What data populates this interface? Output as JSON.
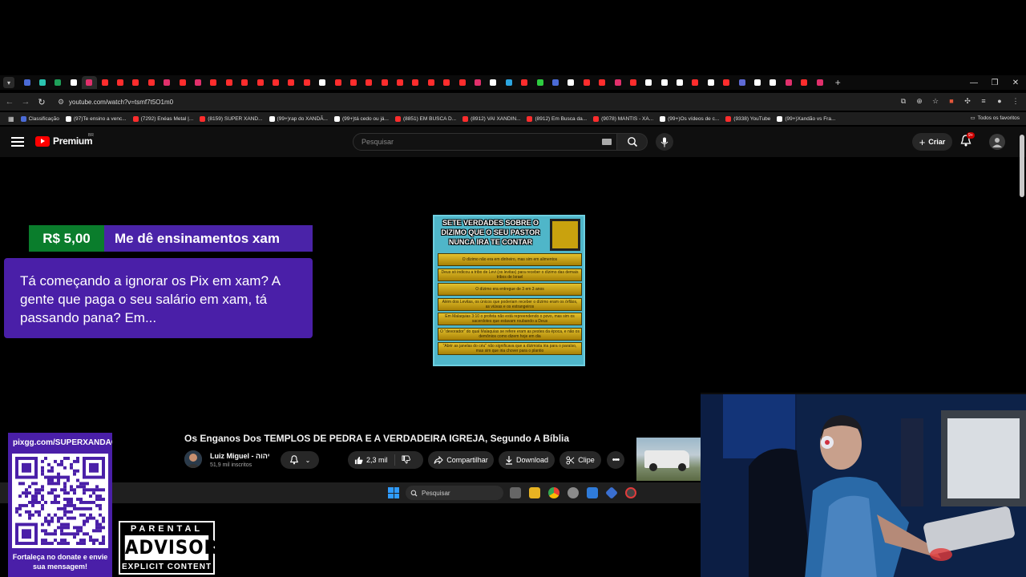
{
  "browser": {
    "url": "youtube.com/watch?v=tsmf7t5O1m0",
    "bookmarks": [
      {
        "label": "Classificação",
        "color": "#4b6bd6"
      },
      {
        "label": "(97)Te ensino a venc...",
        "color": "#ffffff"
      },
      {
        "label": "(7292) Enéas Metal |...",
        "color": "#ff2d2d"
      },
      {
        "label": "(8159) SUPER XAND...",
        "color": "#ff2d2d"
      },
      {
        "label": "(99+)rap do XANDÃ...",
        "color": "#ffffff"
      },
      {
        "label": "(99+)tá cedo ou já...",
        "color": "#ffffff"
      },
      {
        "label": "(8851) EM BUSCA D...",
        "color": "#ff2d2d"
      },
      {
        "label": "(8912) VAI XANDIN...",
        "color": "#ff2d2d"
      },
      {
        "label": "(8912) Em Busca da...",
        "color": "#ff2d2d"
      },
      {
        "label": "(9078) MANTIS - XA...",
        "color": "#ff2d2d"
      },
      {
        "label": "(99+)Os vídeos de c...",
        "color": "#ffffff"
      },
      {
        "label": "(9338) YouTube",
        "color": "#ff2d2d"
      },
      {
        "label": "(99+)Xandão vs Fra...",
        "color": "#ffffff"
      }
    ],
    "bookmarks_all": "Todos os favoritos"
  },
  "youtube": {
    "brand": "Premium",
    "region": "BR",
    "search_placeholder": "Pesquisar",
    "create_label": "Criar",
    "notif_badge": "9+",
    "video_title": "Os Enganos Dos TEMPLOS DE PEDRA E A VERDADEIRA IGREJA, Segundo A Bíblia",
    "channel_name": "Luiz Miguel - יהוה",
    "channel_subs": "51,9 mil inscritos",
    "likes": "2,3 mil",
    "share_label": "Compartilhar",
    "download_label": "Download",
    "clip_label": "Clipe"
  },
  "thumbnail": {
    "title": "SETE VERDADES SOBRE O DIZIMO QUE O SEU PASTOR NUNCA IRA TE CONTAR",
    "rows": [
      "O dízimo não era em dinheiro, mas sim em alimentos",
      "Deus só indicou a tribo de Levi (os levitas) para receber o dízimo das demais tribos de Israel",
      "O dízimo era entregue de 3 em 3 anos",
      "Além dos Levitas, os únicos que poderiam receber o dízimo eram os órfãos, as viúvas e os estrangeiros",
      "Em Malaquias 3:10 o profeta não está repreendendo o povo, mas sim os sacerdotes que estavam roubando a Deus",
      "O \"devorador\" do qual Malaquias se refere eram as pestes da época, e não os demônios como dizem hoje em dia",
      "\"Abrir as janelas do céu\" não significava que a dizimista iria para o paraíso, mas sim que iria chover para o plantio"
    ]
  },
  "donation": {
    "amount": "R$ 5,00",
    "name": "Me dê ensinamentos xam",
    "message": "Tá começando a ignorar os Pix em xam? A gente que paga o seu salário em xam, tá passando pana? Em..."
  },
  "taskbar": {
    "search_placeholder": "Pesquisar"
  },
  "qr": {
    "url": "pixgg.com/SUPERXANDAO",
    "caption": "Fortaleça no donate e envie sua mensagem!"
  },
  "advisory": {
    "top": "PARENTAL",
    "middle": "ADVISORY",
    "bottom": "EXPLICIT CONTENT"
  },
  "colors": {
    "donation_green": "#0a7d2c",
    "donation_purple": "#4a1fa8",
    "youtube_red": "#ff0000"
  }
}
